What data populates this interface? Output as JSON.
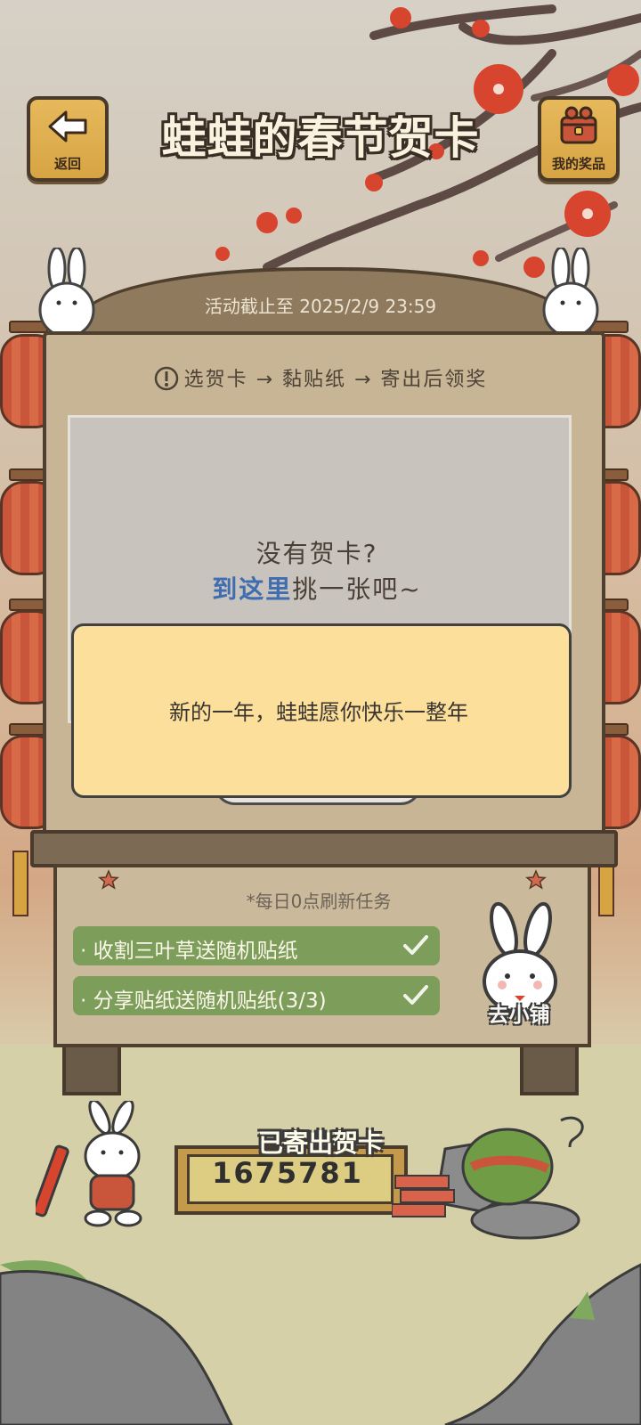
{
  "header": {
    "title": "蛙蛙的春节贺卡",
    "back_label": "返回",
    "prizes_label": "我的奖品"
  },
  "event": {
    "deadline": "活动截止至 2025/2/9 23:59",
    "steps": "选贺卡 → 黏贴纸 → 寄出后领奖"
  },
  "card_area": {
    "empty_title": "没有贺卡?",
    "link_text": "到这里",
    "link_suffix": "挑一张吧~"
  },
  "toast": {
    "message": "新的一年，蛙蛙愿你快乐一整年"
  },
  "tasks": {
    "refresh_note": "*每日0点刷新任务",
    "items": [
      {
        "label": "· 收割三叶草送随机贴纸",
        "done": true
      },
      {
        "label": "· 分享贴纸送随机贴纸(3/3)",
        "done": true
      }
    ],
    "shop_label": "去小铺"
  },
  "counter": {
    "title": "已寄出贺卡",
    "value": "1675781"
  },
  "colors": {
    "task_green": "#7d9d5a",
    "toast_yellow": "#fddf9c",
    "link_blue": "#3f6db0",
    "lantern_red": "#c9553b"
  }
}
